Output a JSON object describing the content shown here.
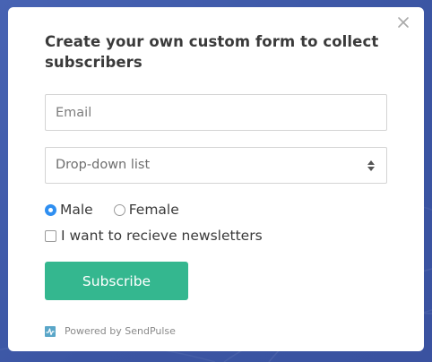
{
  "form": {
    "title": "Create your own custom form to collect subscribers",
    "email_placeholder": "Email",
    "dropdown_value": "Drop-down list",
    "gender_options": [
      {
        "label": "Male",
        "checked": true
      },
      {
        "label": "Female",
        "checked": false
      }
    ],
    "newsletter_label": "I want to recieve newsletters",
    "newsletter_checked": false,
    "subscribe_label": "Subscribe",
    "powered_by": "Powered by SendPulse"
  },
  "icons": {
    "close": "close-icon",
    "dropdown": "sort-arrows-icon",
    "brand": "sendpulse-logo-icon"
  },
  "colors": {
    "backdrop": "#3e5aa8",
    "button": "#34b78f",
    "radio_checked": "#2f8ff1",
    "text": "#3a3a3a"
  }
}
